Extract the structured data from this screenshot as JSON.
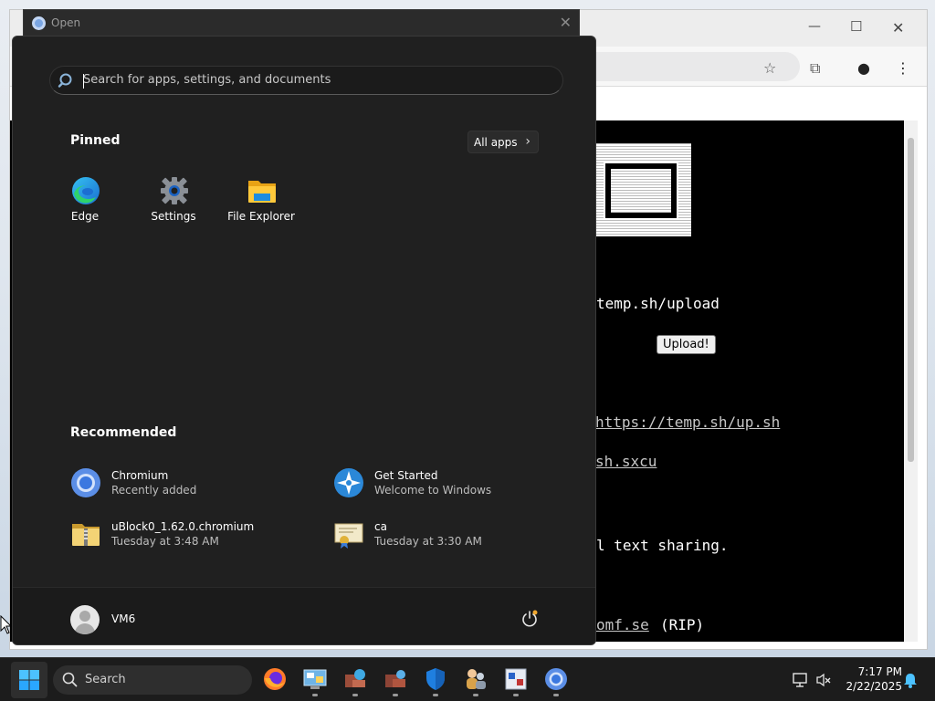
{
  "dialog": {
    "title": "Open"
  },
  "page": {
    "upload_url_fragment": "temp.sh/upload",
    "upload_button": "Upload!",
    "link_upsh": "https://temp.sh/up.sh",
    "link_sxcu": "sh.sxcu",
    "text_sharing": "l text sharing.",
    "link_rip": "omf.se",
    "rip": "(RIP)"
  },
  "start_menu": {
    "search_placeholder": "Search for apps, settings, and documents",
    "pinned_title": "Pinned",
    "all_apps_label": "All apps",
    "pinned": [
      {
        "label": "Edge",
        "icon": "edge-icon"
      },
      {
        "label": "Settings",
        "icon": "gear-icon"
      },
      {
        "label": "File Explorer",
        "icon": "folder-icon"
      }
    ],
    "recommended_title": "Recommended",
    "recommended": [
      {
        "name": "Chromium",
        "sub": "Recently added",
        "icon": "chromium-icon"
      },
      {
        "name": "Get Started",
        "sub": "Welcome to Windows",
        "icon": "get-started-icon"
      },
      {
        "name": "uBlock0_1.62.0.chromium",
        "sub": "Tuesday at 3:48 AM",
        "icon": "zip-folder-icon"
      },
      {
        "name": "ca",
        "sub": "Tuesday at 3:30 AM",
        "icon": "certificate-icon"
      }
    ],
    "user_name": "VM6"
  },
  "taskbar": {
    "search_label": "Search",
    "time": "7:17 PM",
    "date": "2/22/2025"
  },
  "colors": {
    "accent": "#0078d4",
    "menu_bg": "#202020",
    "taskbar_bg": "#1c1c1c"
  }
}
